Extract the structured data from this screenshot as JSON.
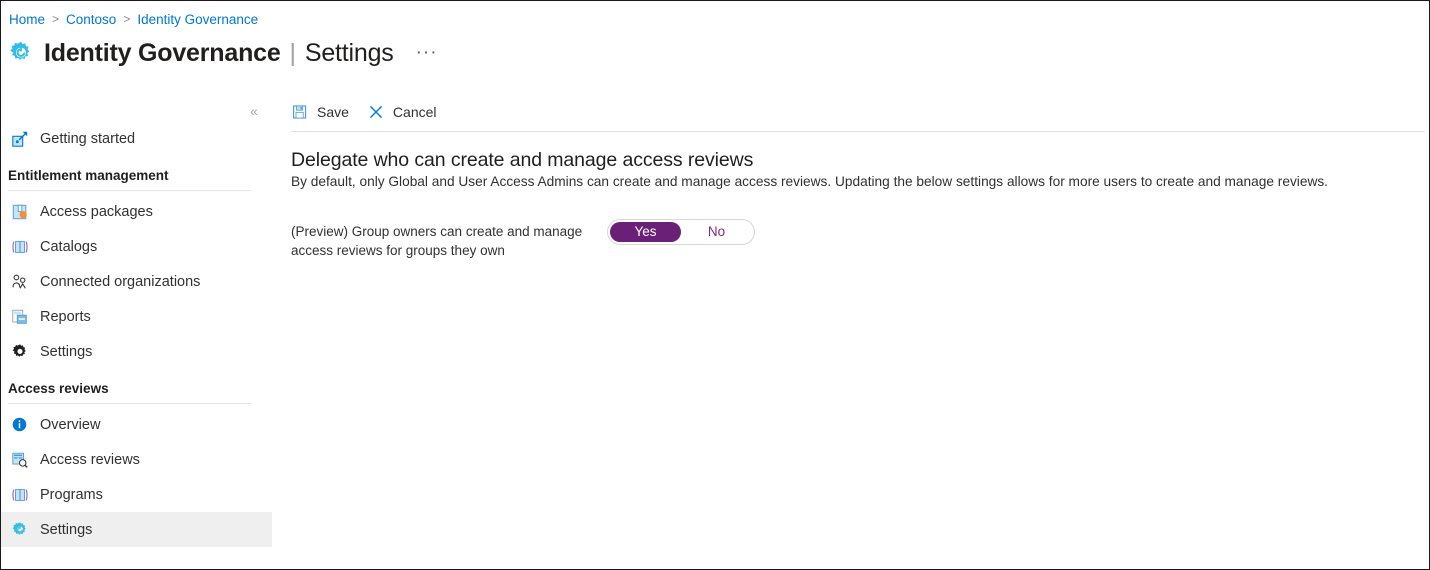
{
  "breadcrumb": {
    "items": [
      {
        "label": "Home"
      },
      {
        "label": "Contoso"
      },
      {
        "label": "Identity Governance"
      }
    ],
    "separator": ">"
  },
  "header": {
    "icon": "gear-icon",
    "title": "Identity Governance",
    "divider": "|",
    "subtitle": "Settings",
    "more_label": "···"
  },
  "sidebar": {
    "collapse_label": "«",
    "top_items": [
      {
        "label": "Getting started",
        "icon": "rocket-icon",
        "selected": false
      }
    ],
    "groups": [
      {
        "title": "Entitlement management",
        "items": [
          {
            "label": "Access packages",
            "icon": "package-icon",
            "selected": false
          },
          {
            "label": "Catalogs",
            "icon": "book-icon",
            "selected": false
          },
          {
            "label": "Connected organizations",
            "icon": "people-icon",
            "selected": false
          },
          {
            "label": "Reports",
            "icon": "reports-icon",
            "selected": false
          },
          {
            "label": "Settings",
            "icon": "gear-dark-icon",
            "selected": false
          }
        ]
      },
      {
        "title": "Access reviews",
        "items": [
          {
            "label": "Overview",
            "icon": "info-icon",
            "selected": false
          },
          {
            "label": "Access reviews",
            "icon": "review-search-icon",
            "selected": false
          },
          {
            "label": "Programs",
            "icon": "book-icon",
            "selected": false
          },
          {
            "label": "Settings",
            "icon": "gear-cyan-icon",
            "selected": true
          }
        ]
      }
    ]
  },
  "toolbar": {
    "save_label": "Save",
    "cancel_label": "Cancel"
  },
  "main": {
    "heading": "Delegate who can create and manage access reviews",
    "description": "By default, only Global and User Access Admins can create and manage access reviews. Updating the below settings allows for more users to create and manage reviews.",
    "setting": {
      "label": "(Preview) Group owners can create and manage access reviews for groups they own",
      "toggle": {
        "yes_label": "Yes",
        "no_label": "No",
        "value": "Yes"
      }
    }
  },
  "colors": {
    "link": "#0078d4",
    "accent_purple": "#6b2077",
    "accent_cyan": "#32bde8",
    "selected_row": "#efefef"
  }
}
